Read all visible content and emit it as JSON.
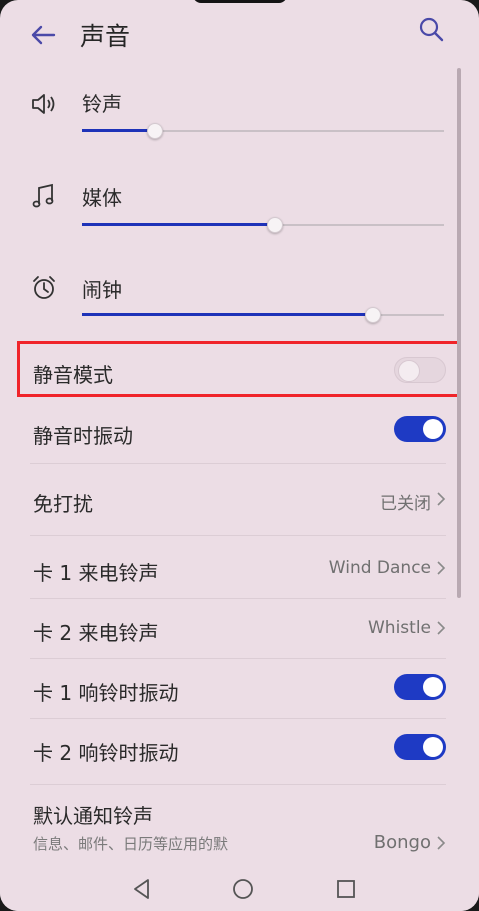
{
  "header": {
    "title": "声音",
    "back_icon": "arrow-left-icon",
    "search_icon": "search-icon"
  },
  "volumes": [
    {
      "label": "铃声",
      "icon": "speaker-icon",
      "level": 0.2
    },
    {
      "label": "媒体",
      "icon": "music-note-icon",
      "level": 0.53
    },
    {
      "label": "闹钟",
      "icon": "alarm-clock-icon",
      "level": 0.8
    }
  ],
  "settings": {
    "silent_mode": {
      "label": "静音模式",
      "on": false
    },
    "vibrate_when_silent": {
      "label": "静音时振动",
      "on": true
    },
    "do_not_disturb": {
      "label": "免打扰",
      "value": "已关闭"
    },
    "sim1_ringtone": {
      "label": "卡 1 来电铃声",
      "value": "Wind Dance"
    },
    "sim2_ringtone": {
      "label": "卡 2 来电铃声",
      "value": "Whistle"
    },
    "sim1_vibrate": {
      "label": "卡 1 响铃时振动",
      "on": true
    },
    "sim2_vibrate": {
      "label": "卡 2 响铃时振动",
      "on": true
    },
    "default_notification": {
      "label": "默认通知铃声",
      "description": "信息、邮件、日历等应用的默",
      "value": "Bongo"
    }
  },
  "navbar": {
    "back_icon": "triangle-back-icon",
    "home_icon": "circle-home-icon",
    "recents_icon": "square-recents-icon"
  },
  "colors": {
    "accent": "#1e3ac4",
    "background": "#ecdde5",
    "highlight_box": "#f0242a"
  }
}
